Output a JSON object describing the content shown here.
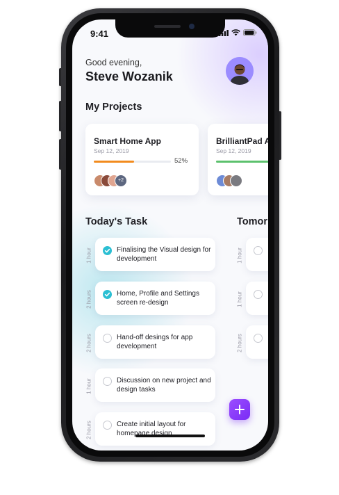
{
  "status_bar": {
    "time": "9:41"
  },
  "header": {
    "greeting": "Good evening,",
    "user_name": "Steve Wozanik"
  },
  "projects": {
    "title": "My Projects",
    "items": [
      {
        "name": "Smart Home App",
        "date": "Sep 12, 2019",
        "progress_percent": 52,
        "progress_label": "52%",
        "progress_color": "#f28b1e",
        "more_label": "+2"
      },
      {
        "name": "BrilliantPad A",
        "date": "Sep 12, 2019",
        "progress_color": "#5cc16d"
      }
    ]
  },
  "today": {
    "title": "Today's Task",
    "tasks": [
      {
        "duration": "1 hour",
        "text": "Finalising the Visual design for development",
        "done": true
      },
      {
        "duration": "2 hours",
        "text": "Home, Profile and Settings screen re-design",
        "done": true
      },
      {
        "duration": "2 hours",
        "text": "Hand-off desings for app development",
        "done": false
      },
      {
        "duration": "1 hour",
        "text": "Discussion on new project and design tasks",
        "done": false
      },
      {
        "duration": "2 hours",
        "text": "Create initial layout for homepage design",
        "done": false
      }
    ]
  },
  "tomorrow": {
    "title": "Tomor",
    "durations": [
      "1 hour",
      "1 hour",
      "2 hours"
    ]
  },
  "colors": {
    "accent": "#8a3cff",
    "check": "#2cbfd3"
  }
}
